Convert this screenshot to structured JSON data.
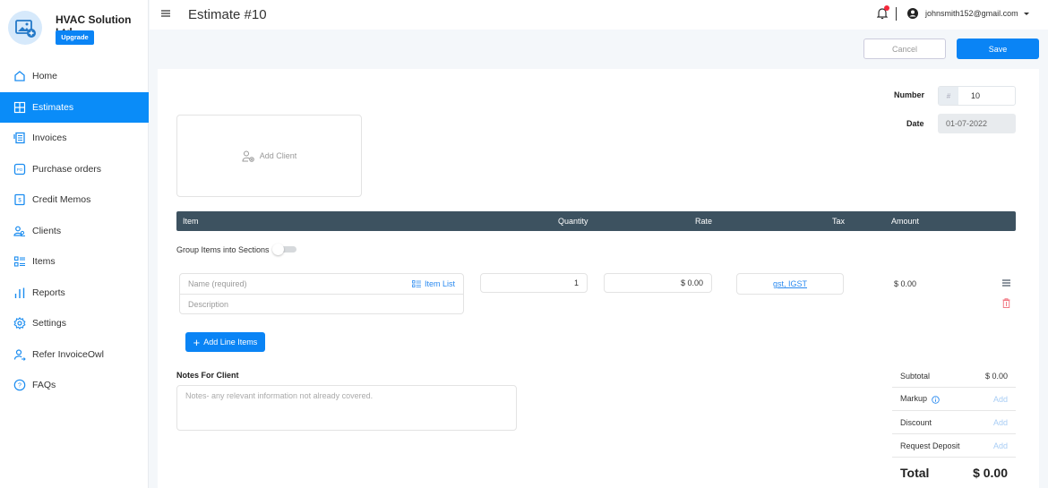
{
  "sidebar": {
    "company_name": "HVAC Solution Ltd",
    "upgrade_label": "Upgrade",
    "items": [
      {
        "label": "Home",
        "icon": "home-icon"
      },
      {
        "label": "Estimates",
        "icon": "estimates-icon",
        "active": true
      },
      {
        "label": "Invoices",
        "icon": "invoices-icon"
      },
      {
        "label": "Purchase orders",
        "icon": "purchase-orders-icon"
      },
      {
        "label": "Credit Memos",
        "icon": "credit-memo-icon"
      },
      {
        "label": "Clients",
        "icon": "clients-icon"
      },
      {
        "label": "Items",
        "icon": "items-icon"
      },
      {
        "label": "Reports",
        "icon": "reports-icon"
      },
      {
        "label": "Settings",
        "icon": "gear-icon"
      },
      {
        "label": "Refer InvoiceOwl",
        "icon": "refer-icon"
      },
      {
        "label": "FAQs",
        "icon": "help-icon"
      }
    ]
  },
  "header": {
    "title": "Estimate #10",
    "user_email": "johnsmith152@gmail.com",
    "has_notification": true
  },
  "actions": {
    "cancel_label": "Cancel",
    "save_label": "Save"
  },
  "estimate": {
    "number_label": "Number",
    "number_prefix": "#",
    "number": "10",
    "date_label": "Date",
    "date": "01-07-2022",
    "add_client_label": "Add Client"
  },
  "table": {
    "columns": [
      "Item",
      "Quantity",
      "Rate",
      "Tax",
      "Amount"
    ],
    "group_label": "Group Items into Sections",
    "group_enabled": false,
    "line_items": [
      {
        "name_placeholder": "Name (required)",
        "description_placeholder": "Description",
        "item_list_label": "Item List",
        "quantity": "1",
        "rate": "$ 0.00",
        "tax": "gst, IGST",
        "amount": "$ 0.00"
      }
    ],
    "add_line_label": "Add Line Items"
  },
  "notes": {
    "label": "Notes For Client",
    "placeholder": "Notes- any relevant information not already covered."
  },
  "totals": {
    "subtotal_label": "Subtotal",
    "subtotal": "$ 0.00",
    "markup_label": "Markup",
    "discount_label": "Discount",
    "deposit_label": "Request Deposit",
    "add_label": "Add",
    "total_label": "Total",
    "total": "$ 0.00"
  },
  "colors": {
    "primary": "#0a84f5",
    "table_header": "#3d5260",
    "danger": "#f5273a"
  }
}
